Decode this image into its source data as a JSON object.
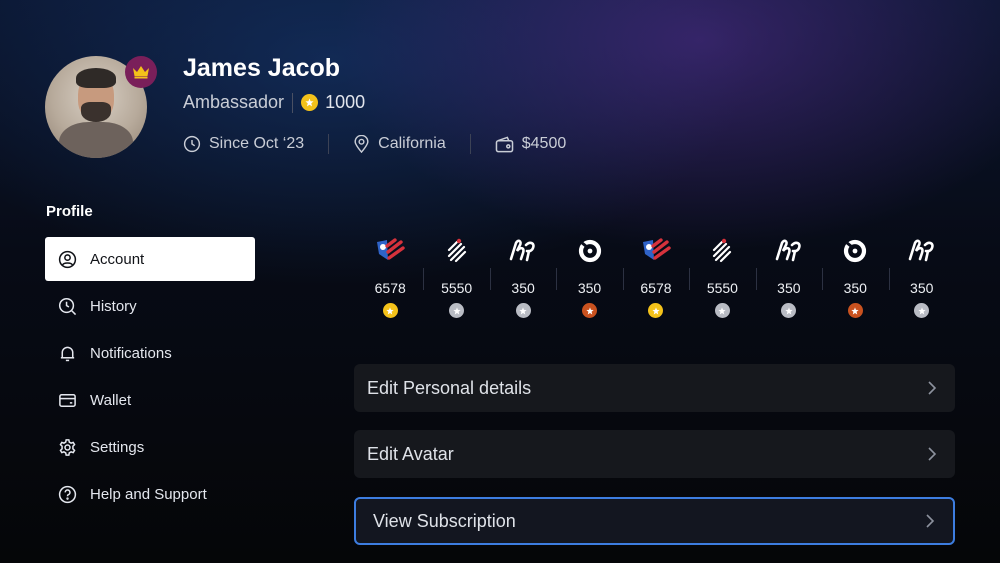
{
  "profile": {
    "name": "James Jacob",
    "rank": "Ambassador",
    "coins": "1000",
    "since": "Since Oct ‘23",
    "location": "California",
    "balance": "$4500"
  },
  "sidebar": {
    "title": "Profile",
    "items": [
      {
        "label": "Account",
        "icon": "user-circle-icon",
        "active": true
      },
      {
        "label": "History",
        "icon": "history-search-icon"
      },
      {
        "label": "Notifications",
        "icon": "bell-icon"
      },
      {
        "label": "Wallet",
        "icon": "card-icon"
      },
      {
        "label": "Settings",
        "icon": "gear-icon"
      },
      {
        "label": "Help and Support",
        "icon": "question-icon"
      }
    ]
  },
  "badges": [
    {
      "value": "6578",
      "icon": "shield-badge-icon",
      "medal": "gold"
    },
    {
      "value": "5550",
      "icon": "stripes-badge-icon",
      "medal": "silver"
    },
    {
      "value": "350",
      "icon": "loop-badge-icon",
      "medal": "silver"
    },
    {
      "value": "350",
      "icon": "ring-badge-icon",
      "medal": "bronze"
    },
    {
      "value": "6578",
      "icon": "shield-badge-icon",
      "medal": "gold"
    },
    {
      "value": "5550",
      "icon": "stripes-badge-icon",
      "medal": "silver"
    },
    {
      "value": "350",
      "icon": "loop-badge-icon",
      "medal": "silver"
    },
    {
      "value": "350",
      "icon": "ring-badge-icon",
      "medal": "bronze"
    },
    {
      "value": "350",
      "icon": "loop-badge-icon",
      "medal": "silver"
    }
  ],
  "actions": [
    {
      "label": "Edit Personal details"
    },
    {
      "label": "Edit Avatar"
    },
    {
      "label": "View Subscription",
      "focused": true
    }
  ],
  "colors": {
    "gold": "#f4c21a",
    "silver": "#b9bcc4",
    "bronze": "#c9521f",
    "focus": "#3d7de0",
    "crown_badge": "#7a1f5a"
  }
}
